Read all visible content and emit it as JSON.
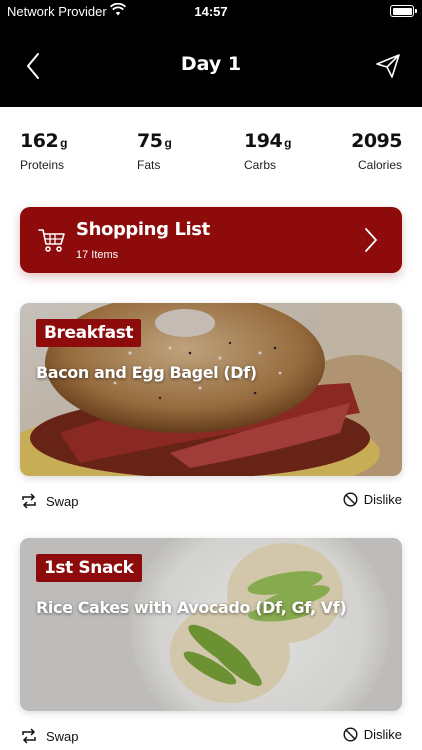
{
  "status_bar": {
    "provider": "Network Provider",
    "time": "14:57"
  },
  "nav": {
    "title": "Day 1"
  },
  "macros": [
    {
      "value": "162",
      "unit": "g",
      "label": "Proteins"
    },
    {
      "value": "75",
      "unit": "g",
      "label": "Fats"
    },
    {
      "value": "194",
      "unit": "g",
      "label": "Carbs"
    },
    {
      "value": "2095",
      "unit": "",
      "label": "Calories"
    }
  ],
  "shopping": {
    "title": "Shopping List",
    "subtitle": "17 Items"
  },
  "meals": [
    {
      "tag": "Breakfast",
      "name": "Bacon and Egg Bagel (Df)"
    },
    {
      "tag": "1st Snack",
      "name": "Rice Cakes with Avocado (Df, Gf, Vf)"
    }
  ],
  "actions": {
    "swap_label": "Swap",
    "dislike_label": "Dislike"
  },
  "colors": {
    "accent": "#8e0b0b",
    "header_bg": "#000000"
  }
}
